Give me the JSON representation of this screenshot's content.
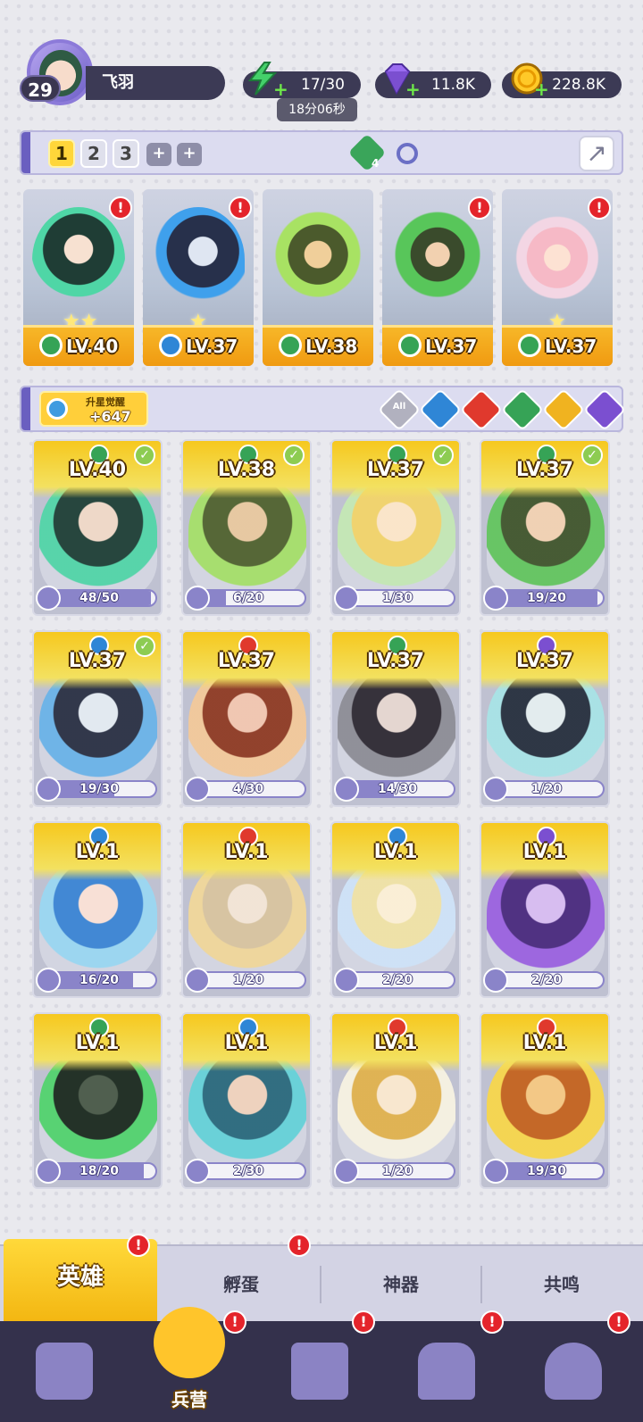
{
  "player": {
    "level": "29",
    "name": "飞羽"
  },
  "resources": {
    "energy": "17/30",
    "gems": "11.8K",
    "coins": "228.8K",
    "timer": "18分06秒"
  },
  "team_bar": {
    "slots": [
      "1",
      "2",
      "3"
    ],
    "gem_count": "4"
  },
  "team_heroes": [
    {
      "level": "LV.40",
      "element": "wind"
    },
    {
      "level": "LV.37",
      "element": "water"
    },
    {
      "level": "LV.38",
      "element": "wind"
    },
    {
      "level": "LV.37",
      "element": "wind"
    },
    {
      "level": "LV.37",
      "element": "wind"
    }
  ],
  "upgrade": {
    "title": "升星觉醒",
    "value": "+647"
  },
  "filters": {
    "all_label": "All"
  },
  "heroes": [
    {
      "level": "LV.40",
      "progress": "48/50",
      "element": "wind",
      "ready": true
    },
    {
      "level": "LV.38",
      "progress": "6/20",
      "element": "wind",
      "ready": true
    },
    {
      "level": "LV.37",
      "progress": "1/30",
      "element": "wind",
      "ready": true
    },
    {
      "level": "LV.37",
      "progress": "19/20",
      "element": "wind",
      "ready": true
    },
    {
      "level": "LV.37",
      "progress": "19/30",
      "element": "water",
      "ready": true
    },
    {
      "level": "LV.37",
      "progress": "4/30",
      "element": "fire",
      "ready": false
    },
    {
      "level": "LV.37",
      "progress": "14/30",
      "element": "wind",
      "ready": false
    },
    {
      "level": "LV.37",
      "progress": "1/20",
      "element": "dark",
      "ready": false
    },
    {
      "level": "LV.1",
      "progress": "16/20",
      "element": "water",
      "ready": false
    },
    {
      "level": "LV.1",
      "progress": "1/20",
      "element": "fire",
      "ready": false
    },
    {
      "level": "LV.1",
      "progress": "2/20",
      "element": "water",
      "ready": false
    },
    {
      "level": "LV.1",
      "progress": "2/20",
      "element": "dark",
      "ready": false
    },
    {
      "level": "LV.1",
      "progress": "18/20",
      "element": "wind",
      "ready": false
    },
    {
      "level": "LV.1",
      "progress": "2/30",
      "element": "water",
      "ready": false
    },
    {
      "level": "LV.1",
      "progress": "1/20",
      "element": "fire",
      "ready": false
    },
    {
      "level": "LV.1",
      "progress": "19/30",
      "element": "fire",
      "ready": false
    }
  ],
  "subtabs": [
    "英雄",
    "孵蛋",
    "神器",
    "共鸣"
  ],
  "bottom_nav": {
    "active_label": "兵营"
  },
  "colors": {
    "wind": "#36a356",
    "water": "#2f86d6",
    "fire": "#e0392d",
    "light": "#f0b320",
    "dark": "#7b4fd0"
  }
}
